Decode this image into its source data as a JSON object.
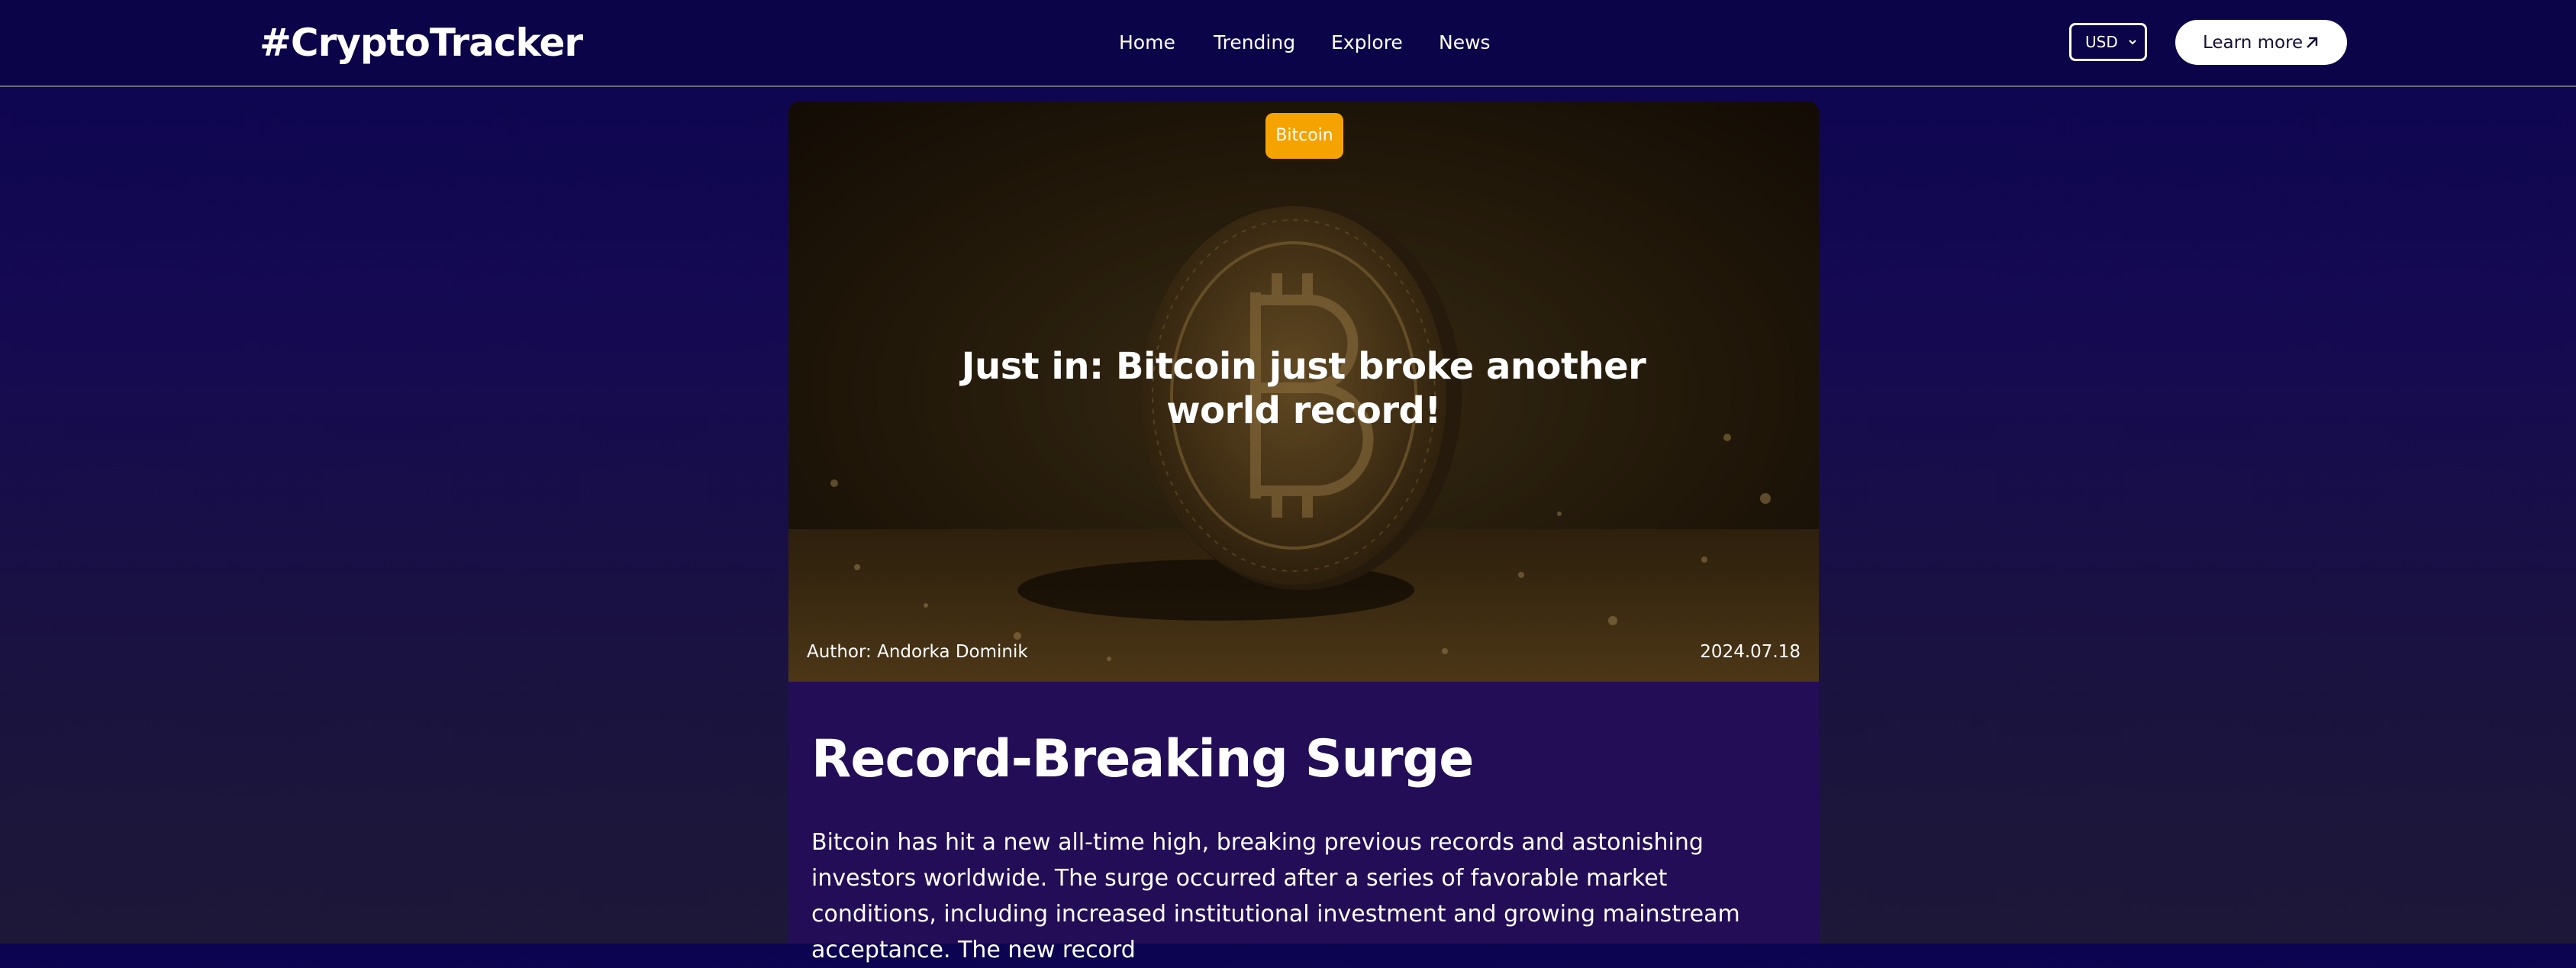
{
  "header": {
    "logo": "#CryptoTracker",
    "nav": [
      {
        "label": "Home"
      },
      {
        "label": "Trending"
      },
      {
        "label": "Explore"
      },
      {
        "label": "News"
      }
    ],
    "currency": {
      "selected": "USD"
    },
    "cta": {
      "label": "Learn more",
      "icon": "arrow-up-right-icon"
    }
  },
  "hero": {
    "tag": "Bitcoin",
    "title": "Just in: Bitcoin just broke another world record!",
    "author": "Author: Andorka Dominik",
    "date": "2024.07.18",
    "image": "bitcoin-coin-on-golden-sand",
    "colors": {
      "tag": "#f5a300"
    }
  },
  "article": {
    "heading": "Record-Breaking Surge",
    "body": "Bitcoin has hit a new all-time high, breaking previous records and astonishing investors worldwide. The surge occurred after a series of favorable market conditions, including increased institutional investment and growing mainstream acceptance. The new record"
  },
  "colors": {
    "background": "#0c0450",
    "header": "#0b0448",
    "article": "#220d56",
    "button": "#ffffff"
  }
}
